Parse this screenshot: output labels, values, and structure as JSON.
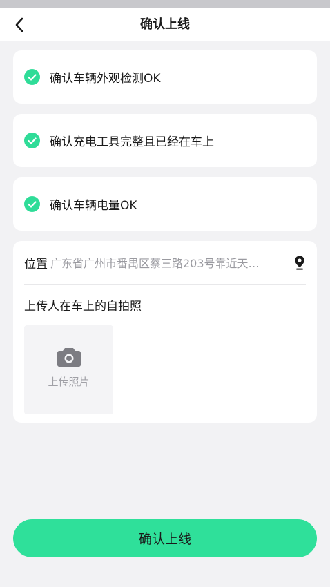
{
  "nav": {
    "title": "确认上线",
    "back_icon": "chevron-left-icon"
  },
  "checklist": [
    {
      "label": "确认车辆外观检测OK",
      "checked": true
    },
    {
      "label": "确认充电工具完整且已经在车上",
      "checked": true
    },
    {
      "label": "确认车辆电量OK",
      "checked": true
    }
  ],
  "location": {
    "label": "位置",
    "value": "广东省广州市番禺区蔡三路203号靠近天…",
    "icon": "map-pin-icon"
  },
  "selfie": {
    "label": "上传人在车上的自拍照",
    "upload_text": "上传照片",
    "upload_icon": "camera-icon"
  },
  "submit": {
    "label": "确认上线"
  },
  "colors": {
    "accent": "#2fe09a",
    "background": "#f2f2f4",
    "card": "#ffffff",
    "muted_text": "#9a9aa0"
  }
}
